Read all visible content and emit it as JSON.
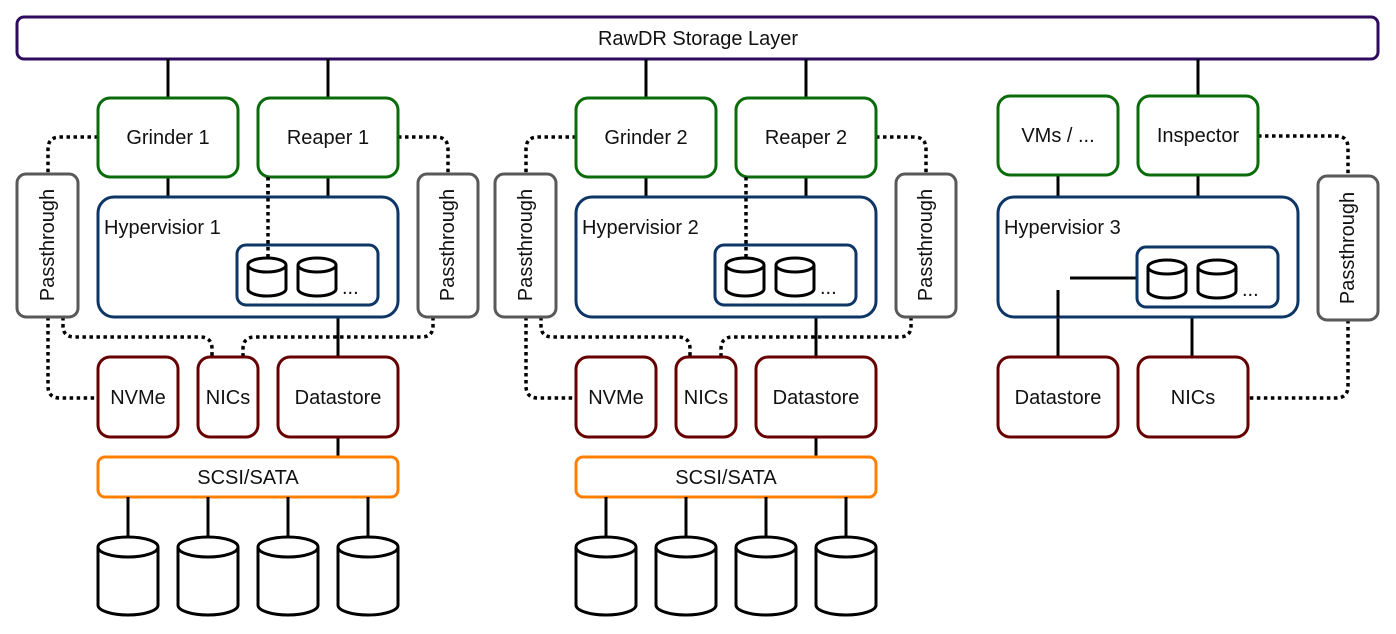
{
  "storage_layer": {
    "label": "RawDR Storage Layer",
    "color": "#2e0b5e"
  },
  "colors": {
    "vm_boxes": "#0a6b0a",
    "hypervisor": "#0d3566",
    "passthrough": "#595959",
    "devices": "#660000",
    "bus": "#ff8000"
  },
  "group1": {
    "grinder": "Grinder 1",
    "reaper": "Reaper 1",
    "hypervisor": "Hypervisior 1",
    "passthrough_left": "Passthrough",
    "passthrough_right": "Passthrough",
    "nvme": "NVMe",
    "nics": "NICs",
    "datastore": "Datastore",
    "bus": "SCSI/SATA",
    "ellipsis": "..."
  },
  "group2": {
    "grinder": "Grinder 2",
    "reaper": "Reaper 2",
    "hypervisor": "Hypervisior 2",
    "passthrough_left": "Passthrough",
    "passthrough_right": "Passthrough",
    "nvme": "NVMe",
    "nics": "NICs",
    "datastore": "Datastore",
    "bus": "SCSI/SATA",
    "ellipsis": "..."
  },
  "group3": {
    "vms": "VMs / ...",
    "inspector": "Inspector",
    "hypervisor": "Hypervisior 3",
    "passthrough": "Passthrough",
    "datastore": "Datastore",
    "nics": "NICs",
    "ellipsis": "..."
  }
}
